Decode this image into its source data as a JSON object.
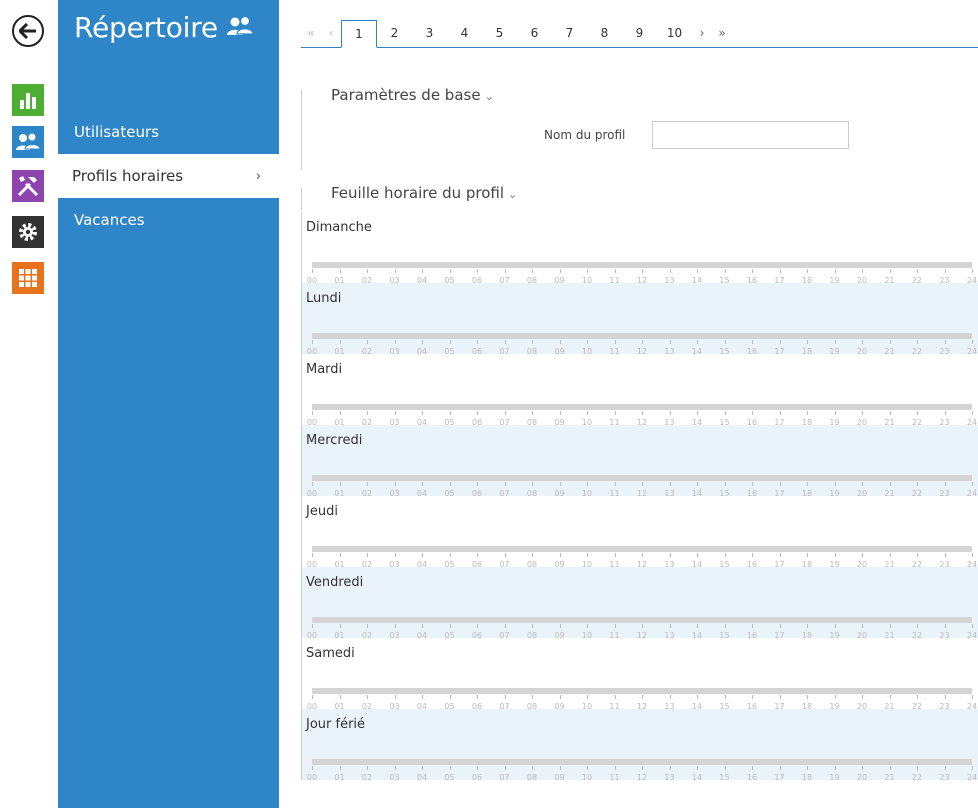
{
  "rail": {
    "icons": [
      {
        "name": "back-icon"
      },
      {
        "name": "status-chart-icon",
        "color": "#4caf32"
      },
      {
        "name": "users-icon",
        "color": "#2e86c8"
      },
      {
        "name": "tools-icon",
        "color": "#8e44ad"
      },
      {
        "name": "settings-gear-icon",
        "color": "#333333"
      },
      {
        "name": "grid-icon",
        "color": "#e8731c"
      }
    ]
  },
  "sidebar": {
    "title": "Répertoire",
    "items": [
      {
        "label": "Utilisateurs"
      },
      {
        "label": "Profils horaires",
        "active": true
      },
      {
        "label": "Vacances"
      }
    ]
  },
  "pager": {
    "first": "«",
    "prev": "‹",
    "pages": [
      "1",
      "2",
      "3",
      "4",
      "5",
      "6",
      "7",
      "8",
      "9",
      "10"
    ],
    "active": "1",
    "next": "›",
    "last": "»"
  },
  "basic": {
    "header": "Paramètres de base",
    "profile_name_label": "Nom du profil",
    "profile_name_value": ""
  },
  "schedule": {
    "header": "Feuille horaire du profil",
    "days": [
      "Dimanche",
      "Lundi",
      "Mardi",
      "Mercredi",
      "Jeudi",
      "Vendredi",
      "Samedi",
      "Jour férié"
    ],
    "hours": [
      "00",
      "01",
      "02",
      "03",
      "04",
      "05",
      "06",
      "07",
      "08",
      "09",
      "10",
      "11",
      "12",
      "13",
      "14",
      "15",
      "16",
      "17",
      "18",
      "19",
      "20",
      "21",
      "22",
      "23",
      "24"
    ]
  },
  "colors": {
    "accent": "#2e86c8",
    "alt_row": "#eaf2fa"
  }
}
